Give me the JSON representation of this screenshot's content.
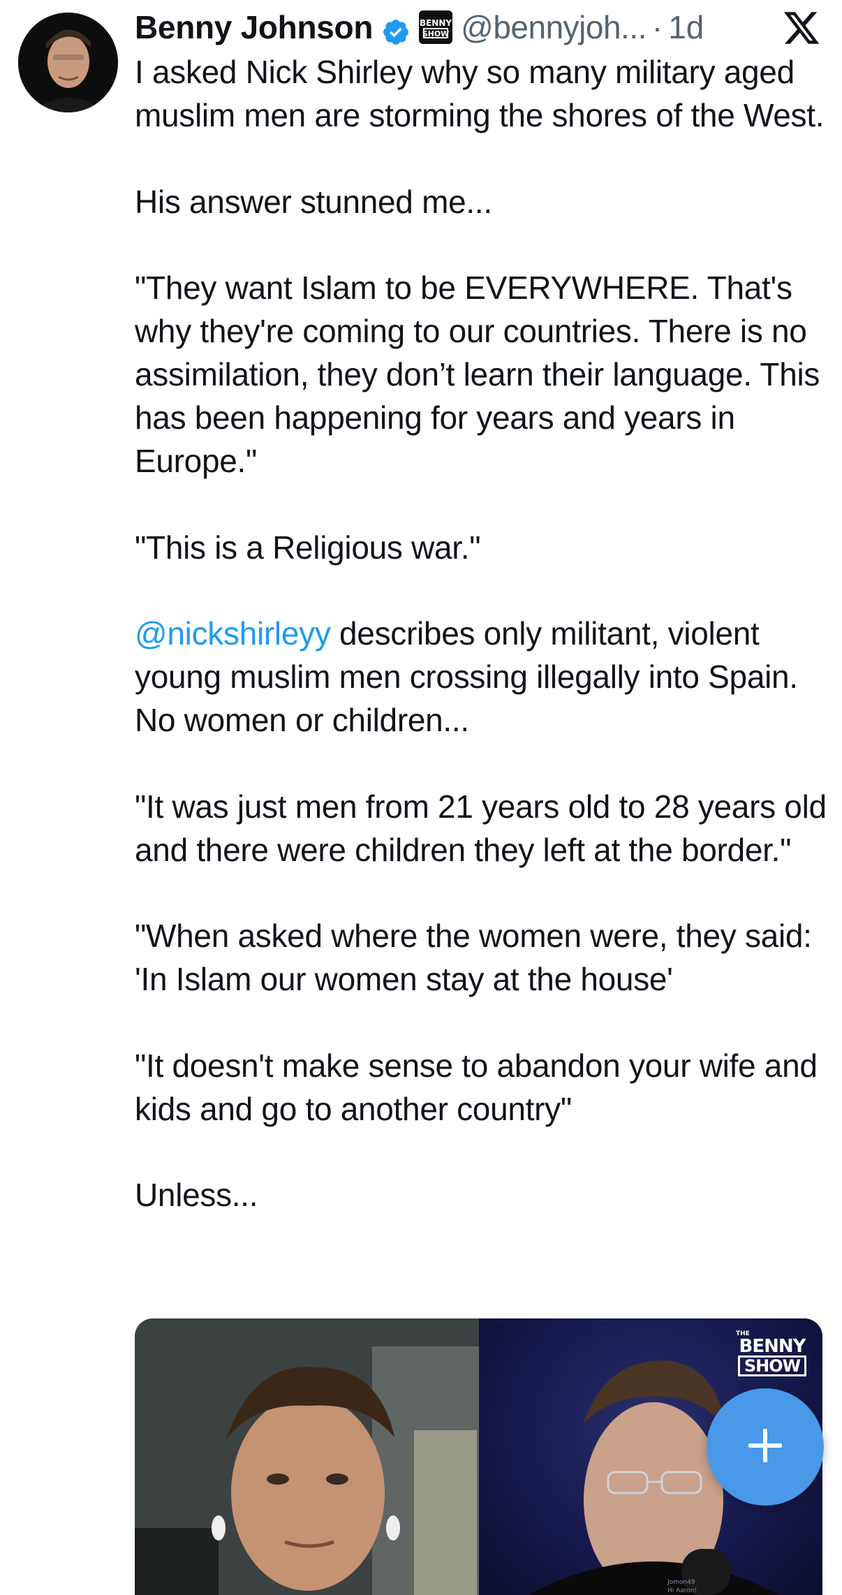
{
  "author": {
    "display_name": "Benny Johnson",
    "handle": "@bennyjoh...",
    "separator": "·",
    "time": "1d",
    "affiliate_badge_text": "BENNY SHOW"
  },
  "tweet": {
    "paragraphs": [
      "I asked Nick Shirley why so many military aged muslim men are storming the shores of the West.",
      "His answer stunned me...",
      "\"They want Islam to be EVERYWHERE. That's why they're coming to our countries. There is no assimilation, they don’t learn their language. This has been happening for years and years in Europe.\"",
      "\"This is a Religious war.\"",
      null,
      "\"It was just men from 21 years old to 28 years old and there were children they left at the border.\"",
      "\"When asked where the women were, they said: 'In Islam our women stay at the house'",
      "\"It doesn't make sense to abandon your wife and kids and go to another country\"",
      "Unless..."
    ],
    "mention": "@nickshirleyy",
    "mention_paragraph_rest": " describes only militant, violent young muslim men crossing illegally into Spain. No women or children..."
  },
  "media": {
    "brand_small": "THE",
    "brand_top": "BENNY",
    "brand_bottom": "SHOW",
    "lower_third_name": "Jomon49",
    "lower_third_sub": "Hi Aaron!"
  },
  "icons": {
    "verified": "verified-badge-icon",
    "platform": "x-logo-icon",
    "compose": "plus-icon"
  },
  "colors": {
    "verified_blue": "#1d9bf0",
    "mention_blue": "#1d9bf0",
    "fab_blue": "#4a99e9",
    "secondary_text": "#536471",
    "primary_text": "#0f1419"
  }
}
